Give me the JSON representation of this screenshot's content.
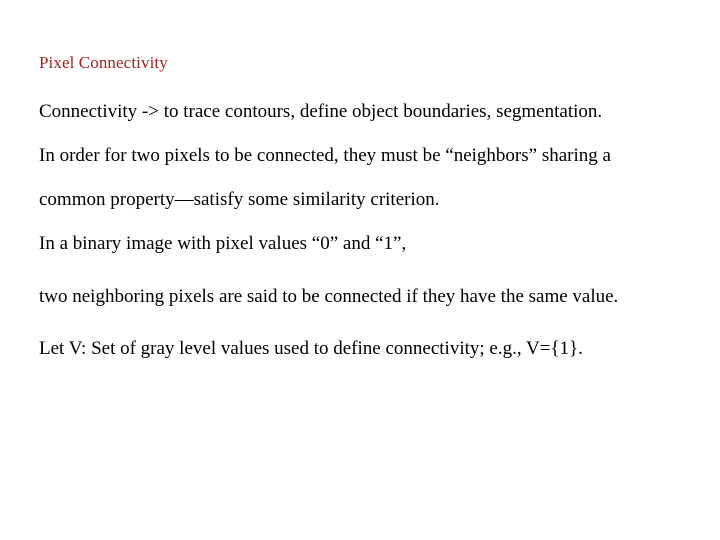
{
  "slide": {
    "title": "Pixel Connectivity",
    "title_color": "#A32222",
    "body_color": "#000000",
    "background_color": "#FFFFFF",
    "paragraphs": [
      {
        "id": "p1",
        "text": "Connectivity -> to trace contours, define object boundaries, segmentation."
      },
      {
        "id": "p2",
        "text": "In order for two pixels to be connected, they must be “neighbors” sharing a common property—satisfy some similarity criterion."
      },
      {
        "id": "p3",
        "text": "In a binary image with pixel values “0” and “1”,"
      },
      {
        "id": "p4",
        "text": "two neighboring pixels are said to be connected if they have the same value."
      },
      {
        "id": "p5",
        "text": "Let V: Set of gray level values used to define connectivity; e.g., V={1}."
      }
    ]
  }
}
